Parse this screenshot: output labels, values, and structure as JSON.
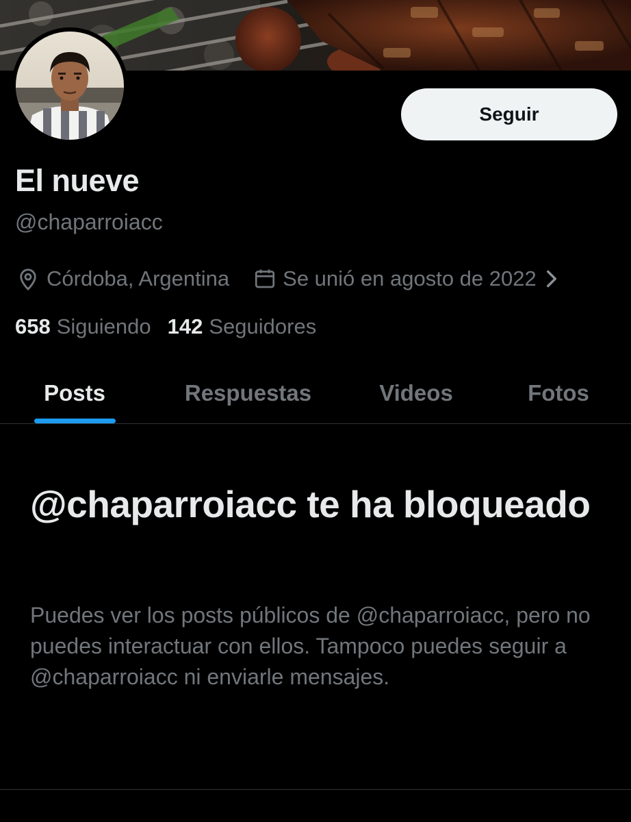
{
  "header": {
    "banner_icon": "grill-photo-banner"
  },
  "profile": {
    "avatar_icon": "profile-photo-avatar",
    "display_name": "El nueve",
    "handle": "@chaparroiacc",
    "follow_label": "Seguir",
    "location": "Córdoba, Argentina",
    "location_icon": "location-pin-icon",
    "joined": "Se unió en agosto de 2022",
    "joined_icon": "calendar-icon",
    "following_count": "658",
    "following_label": "Siguiendo",
    "followers_count": "142",
    "followers_label": "Seguidores"
  },
  "tabs": [
    {
      "label": "Posts",
      "active": true
    },
    {
      "label": "Respuestas",
      "active": false
    },
    {
      "label": "Videos",
      "active": false
    },
    {
      "label": "Fotos",
      "active": false
    }
  ],
  "blocked": {
    "title": "@chaparroiacc te ha bloqueado",
    "message": "Puedes ver los posts públicos de @chaparroiacc, pero no puedes interactuar con ellos. Tampoco puedes seguir a @chaparroiacc ni enviarle mensajes."
  },
  "colors": {
    "background": "#000000",
    "text_primary": "#e7e9ea",
    "text_secondary": "#71767b",
    "accent": "#1d9bf0",
    "button_bg": "#eff3f4"
  }
}
